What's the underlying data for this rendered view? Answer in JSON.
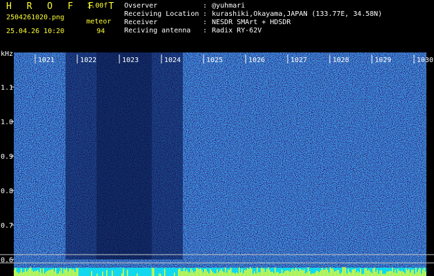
{
  "header": {
    "app_name": "H R O F F T",
    "version": "1.00f",
    "filename": "2504261020.png",
    "datetime": "25.04.26 10:20",
    "mode": "meteor",
    "count": "94"
  },
  "info": [
    {
      "label": "Ovserver",
      "value": "@yuhmari"
    },
    {
      "label": "Receiving Location",
      "value": "kurashiki,Okayama,JAPAN (133.77E, 34.58N)"
    },
    {
      "label": "Receiver",
      "value": "NESDR SMArt + HDSDR"
    },
    {
      "label": "Reciving antenna",
      "value": "Radix RY-62V"
    }
  ],
  "plot": {
    "unit": "kHz",
    "x_labels": [
      "1021",
      "1022",
      "1023",
      "1024",
      "1025",
      "1026",
      "1027",
      "1028",
      "1029",
      "1030"
    ],
    "y_labels": [
      "1.1",
      "1.0",
      "0.9",
      "0.8",
      "0.7",
      "0.6"
    ]
  },
  "colors": {
    "header_text": "#ffff33",
    "info_text": "#ffffff",
    "status_text": "#33ff33",
    "spectrogram_bg": "#0a1a78"
  }
}
